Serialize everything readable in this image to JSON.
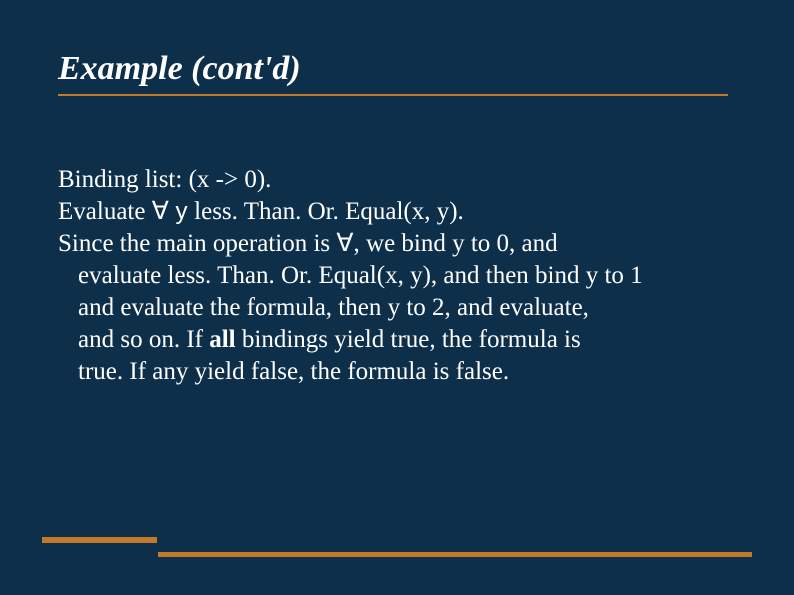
{
  "slide": {
    "title": "Example (cont'd)",
    "body": {
      "line1": "Binding list: (x -> 0).",
      "line2_pre": "Evaluate ",
      "line2_forall": "∀",
      "line2_y": " y ",
      "line2_post": "less. Than. Or. Equal(x, y).",
      "line3_pre": "Since the main operation is ",
      "line3_forall": "∀",
      "line3_post": ", we bind y to 0, and",
      "line4": "evaluate less. Than. Or. Equal(x, y), and then bind y to 1",
      "line5": "and evaluate the formula, then y to 2, and evaluate,",
      "line6_pre": "and so on. If ",
      "line6_bold": "all",
      "line6_post": " bindings yield true, the formula is",
      "line7": "true. If any yield false, the formula is false."
    }
  }
}
